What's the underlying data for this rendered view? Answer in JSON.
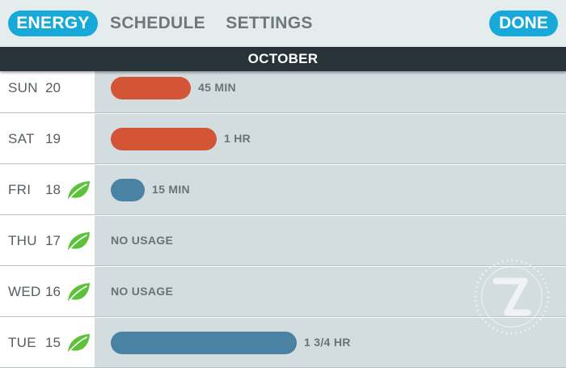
{
  "nav": {
    "tabs": [
      {
        "label": "ENERGY",
        "active": true
      },
      {
        "label": "SCHEDULE",
        "active": false
      },
      {
        "label": "SETTINGS",
        "active": false
      }
    ],
    "done_label": "DONE"
  },
  "month": "OCTOBER",
  "colors": {
    "accent": "#17a9d9",
    "heating_bar": "#d35536",
    "cooling_bar": "#4a82a3",
    "leaf": "#5cc23a",
    "header_bar": "#283339"
  },
  "days": [
    {
      "dow": "SUN",
      "date": "20",
      "leaf": false,
      "usage_label": "45 MIN",
      "bar_color": "red",
      "usage_fraction": 0.43
    },
    {
      "dow": "SAT",
      "date": "19",
      "leaf": false,
      "usage_label": "1 HR",
      "bar_color": "red",
      "usage_fraction": 0.57
    },
    {
      "dow": "FRI",
      "date": "18",
      "leaf": true,
      "usage_label": "15 MIN",
      "bar_color": "blue",
      "usage_fraction": 0.18
    },
    {
      "dow": "THU",
      "date": "17",
      "leaf": true,
      "usage_label": "NO USAGE",
      "bar_color": null,
      "usage_fraction": 0
    },
    {
      "dow": "WED",
      "date": "16",
      "leaf": true,
      "usage_label": "NO USAGE",
      "bar_color": null,
      "usage_fraction": 0
    },
    {
      "dow": "TUE",
      "date": "15",
      "leaf": true,
      "usage_label": "1 3/4 HR",
      "bar_color": "blue",
      "usage_fraction": 1.0
    }
  ]
}
